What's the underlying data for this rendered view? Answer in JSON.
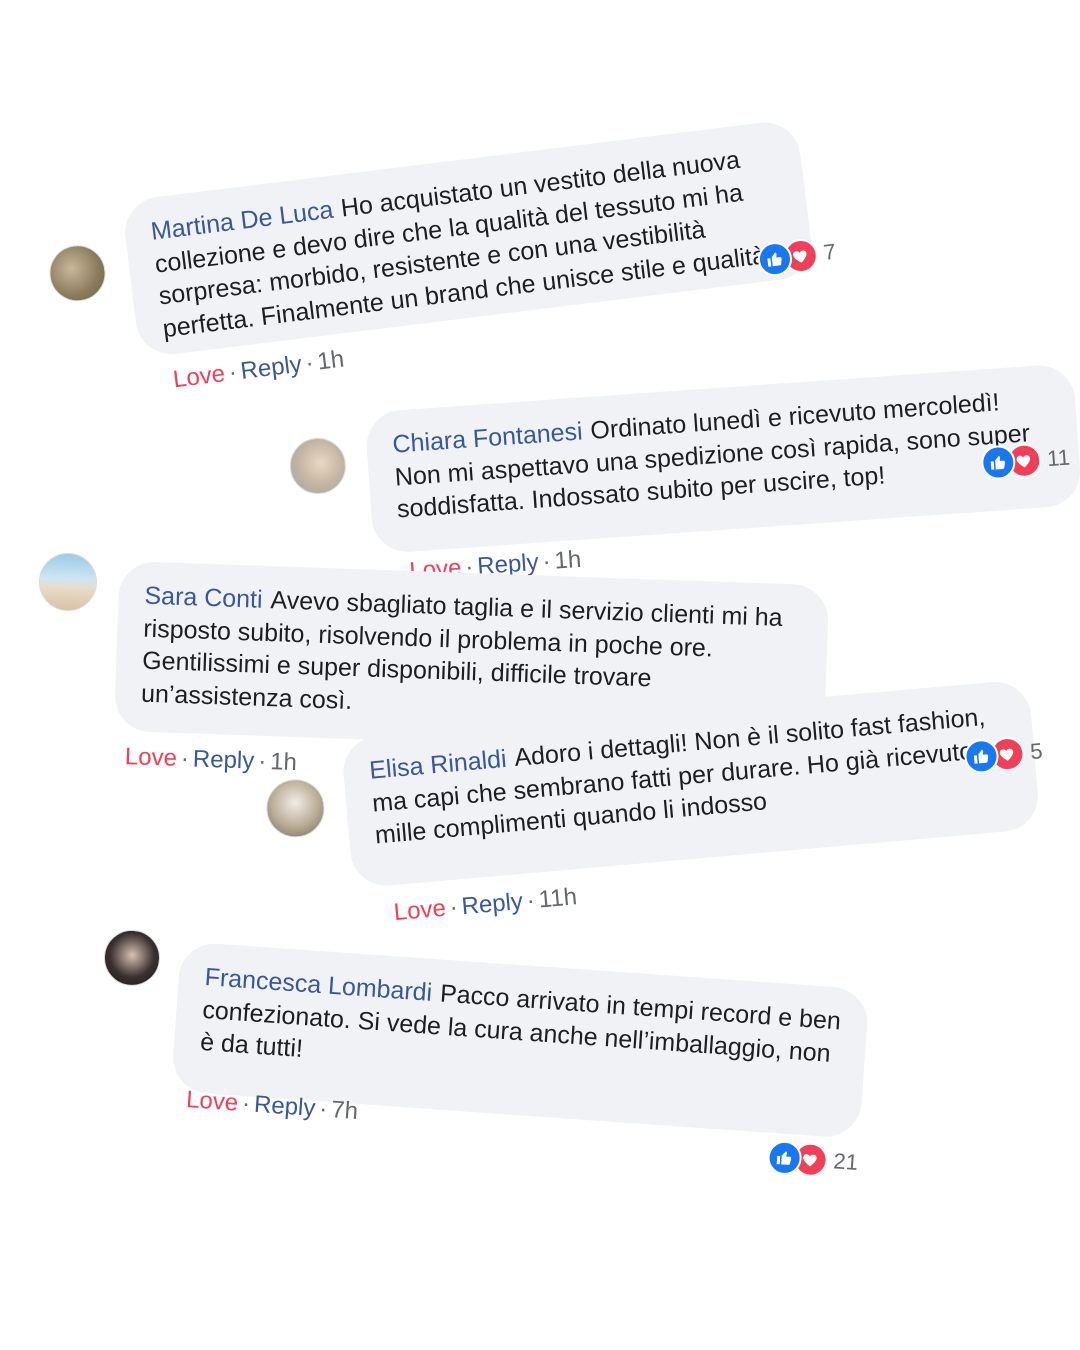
{
  "comments": [
    {
      "author": "Martina De Luca",
      "text": "Ho acquistato un vestito della nuova collezione e devo dire che la qualità del tessuto mi ha sorpresa: morbido, resistente e con una vestibilità perfetta. Finalmente un brand che unisce stile e qualità!",
      "reaction_count": "7",
      "love": "Love",
      "reply": "Reply",
      "time": "1h"
    },
    {
      "author": "Chiara Fontanesi",
      "text": "Ordinato lunedì e ricevuto mercoledì! Non mi aspettavo una spedizione così rapida, sono super soddisfatta. Indossato subito per uscire, top!",
      "reaction_count": "11",
      "love": "Love",
      "reply": "Reply",
      "time": "1h"
    },
    {
      "author": "Sara Conti",
      "text": "Avevo sbagliato taglia e il servizio clienti mi ha risposto subito, risolvendo il problema in poche ore. Gentilissimi e super disponibili, difficile trovare un’assistenza così.",
      "love": "Love",
      "reply": "Reply",
      "time": "1h"
    },
    {
      "author": "Elisa Rinaldi",
      "text": "Adoro i dettagli! Non è il solito fast fashion, ma capi che sembrano fatti per durare. Ho già ricevuto mille complimenti quando li indosso",
      "reaction_count": "5",
      "love": "Love",
      "reply": "Reply",
      "time": "11h"
    },
    {
      "author": "Francesca Lombardi",
      "text": "Pacco arrivato in tempi record e ben confezionato. Si vede la cura anche nell’imballaggio, non è da tutti!",
      "reaction_count": "21",
      "love": "Love",
      "reply": "Reply",
      "time": "7h"
    }
  ],
  "colors": {
    "author": "#385898",
    "bubble": "#f0f2f5",
    "love": "#f33e58",
    "like": "#1877f2",
    "meta": "#65676b"
  }
}
